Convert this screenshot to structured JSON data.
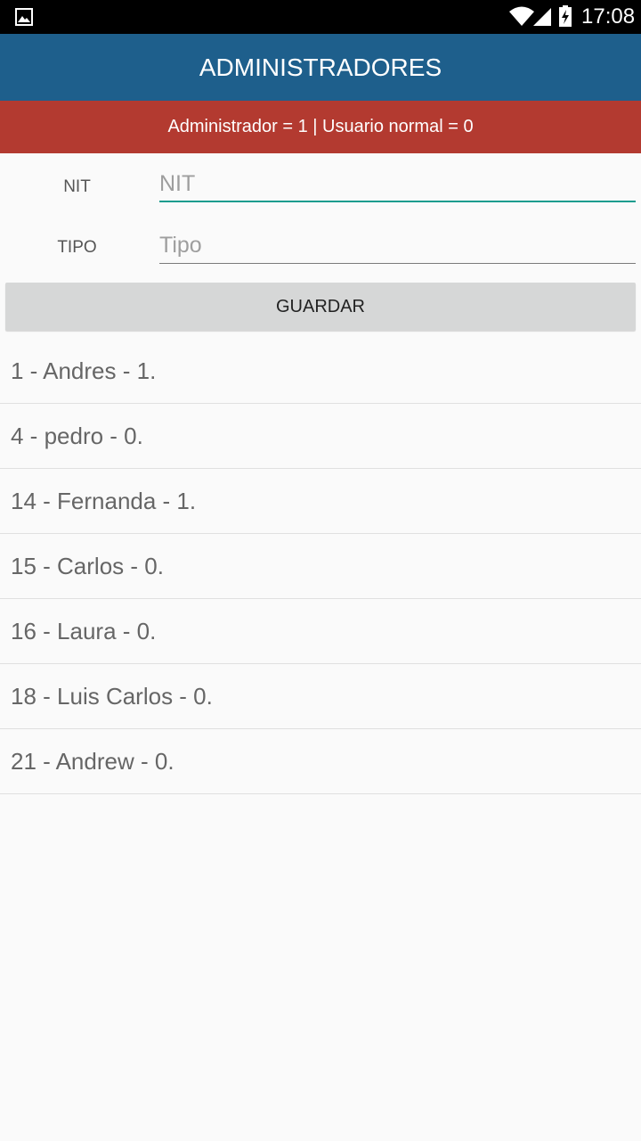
{
  "status_bar": {
    "time": "17:08",
    "icons": [
      "gallery-icon",
      "wifi-icon",
      "signal-icon",
      "battery-charging-icon"
    ]
  },
  "app_bar": {
    "title": "ADMINISTRADORES"
  },
  "banner": {
    "text": "Administrador = 1 | Usuario normal = 0"
  },
  "form": {
    "nit": {
      "label": "NIT",
      "placeholder": "NIT",
      "value": ""
    },
    "tipo": {
      "label": "TIPO",
      "placeholder": "Tipo",
      "value": ""
    },
    "save_label": "GUARDAR"
  },
  "list": {
    "items": [
      "1 - Andres - 1.",
      "4 - pedro - 0.",
      "14 - Fernanda - 1.",
      "15 - Carlos - 0.",
      "16 - Laura - 0.",
      "18 - Luis Carlos - 0.",
      "21 - Andrew - 0."
    ]
  },
  "colors": {
    "app_bar": "#1e5f8c",
    "banner": "#b33a30",
    "accent": "#199c8e",
    "button": "#d6d7d7"
  }
}
